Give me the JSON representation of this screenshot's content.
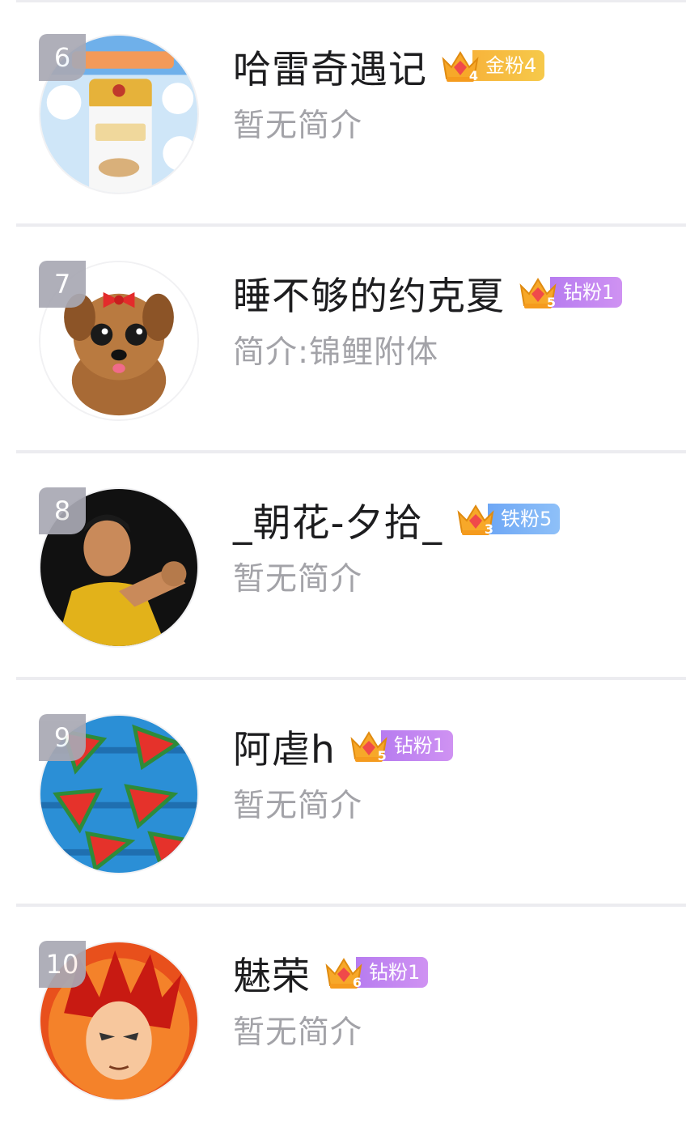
{
  "list": {
    "items": [
      {
        "rank": "6",
        "name": "哈雷奇遇记",
        "bio": "暂无简介",
        "crown_level": "4",
        "badge_label": "金粉4",
        "badge_type": "gold",
        "avatar_icon": "milk-powder-can"
      },
      {
        "rank": "7",
        "name": "睡不够的约克夏",
        "bio": "简介:锦鲤附体",
        "crown_level": "5",
        "badge_label": "钻粉1",
        "badge_type": "diamond",
        "avatar_icon": "yorkshire-puppy"
      },
      {
        "rank": "8",
        "name": "_朝花-夕拾_",
        "bio": "暂无简介",
        "crown_level": "3",
        "badge_label": "铁粉5",
        "badge_type": "iron",
        "avatar_icon": "martial-artist"
      },
      {
        "rank": "9",
        "name": "阿虐h",
        "bio": "暂无简介",
        "crown_level": "5",
        "badge_label": "钻粉1",
        "badge_type": "diamond",
        "avatar_icon": "watermelon-slices"
      },
      {
        "rank": "10",
        "name": "魅荣",
        "bio": "暂无简介",
        "crown_level": "6",
        "badge_label": "钻粉1",
        "badge_type": "diamond",
        "avatar_icon": "anime-warrior"
      }
    ]
  },
  "colors": {
    "gold": "#f7b43b",
    "diamond": "#b77cf0",
    "iron": "#6ea7f5",
    "rank_bg": "#a9a9b4",
    "bio_text": "#a3a3a8"
  }
}
